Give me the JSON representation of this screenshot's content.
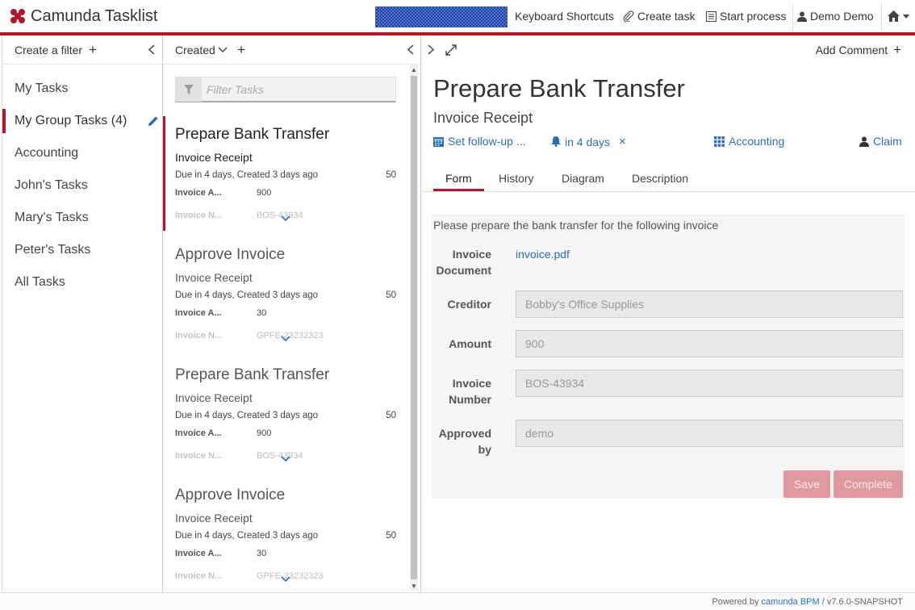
{
  "header": {
    "app_title": "Camunda Tasklist",
    "nav": {
      "keyboard_shortcuts": "Keyboard Shortcuts",
      "create_task": "Create task",
      "start_process": "Start process",
      "user": "Demo Demo"
    }
  },
  "filters": {
    "create_filter": "Create a filter",
    "items": [
      {
        "label": "My Tasks"
      },
      {
        "label": "My Group Tasks",
        "count": "(4)"
      },
      {
        "label": "Accounting"
      },
      {
        "label": "John's Tasks"
      },
      {
        "label": "Mary's Tasks"
      },
      {
        "label": "Peter's Tasks"
      },
      {
        "label": "All Tasks"
      }
    ]
  },
  "tasklist": {
    "sort_label": "Created",
    "search_placeholder": "Filter Tasks",
    "tasks": [
      {
        "name": "Prepare Bank Transfer",
        "process": "Invoice Receipt",
        "due": "Due in 4 days, Created 3 days ago",
        "priority": "50",
        "var1_key": "Invoice A...",
        "var1_val": "900",
        "var2_key": "Invoice N...",
        "var2_val": "BOS-43934"
      },
      {
        "name": "Approve Invoice",
        "process": "Invoice Receipt",
        "due": "Due in 4 days, Created 3 days ago",
        "priority": "50",
        "var1_key": "Invoice A...",
        "var1_val": "30",
        "var2_key": "Invoice N...",
        "var2_val": "GPFE-23232323"
      },
      {
        "name": "Prepare Bank Transfer",
        "process": "Invoice Receipt",
        "due": "Due in 4 days, Created 3 days ago",
        "priority": "50",
        "var1_key": "Invoice A...",
        "var1_val": "900",
        "var2_key": "Invoice N...",
        "var2_val": "BOS-43934"
      },
      {
        "name": "Approve Invoice",
        "process": "Invoice Receipt",
        "due": "Due in 4 days, Created 3 days ago",
        "priority": "50",
        "var1_key": "Invoice A...",
        "var1_val": "30",
        "var2_key": "Invoice N...",
        "var2_val": "GPFE-23232323"
      }
    ]
  },
  "detail": {
    "add_comment": "Add Comment",
    "title": "Prepare Bank Transfer",
    "process": "Invoice Receipt",
    "follow_up": "Set follow-up ...",
    "due": "in 4 days",
    "group": "Accounting",
    "claim": "Claim",
    "tabs": [
      "Form",
      "History",
      "Diagram",
      "Description"
    ],
    "form": {
      "intro": "Please prepare the bank transfer for the following invoice",
      "document_label_1": "Invoice",
      "document_label_2": "Document",
      "document_link": "invoice.pdf",
      "creditor_label": "Creditor",
      "creditor_value": "Bobby's Office Supplies",
      "amount_label": "Amount",
      "amount_value": "900",
      "number_label_1": "Invoice",
      "number_label_2": "Number",
      "number_value": "BOS-43934",
      "approved_label_1": "Approved",
      "approved_label_2": "by",
      "approved_value": "demo",
      "save": "Save",
      "complete": "Complete"
    }
  },
  "footer": {
    "powered_by": "Powered by",
    "product": "camunda BPM",
    "version": "/ v7.6.0-SNAPSHOT"
  },
  "colors": {
    "accent": "#b5152b",
    "link": "#2a6ebb",
    "disabled_button": "#e09a9f"
  }
}
